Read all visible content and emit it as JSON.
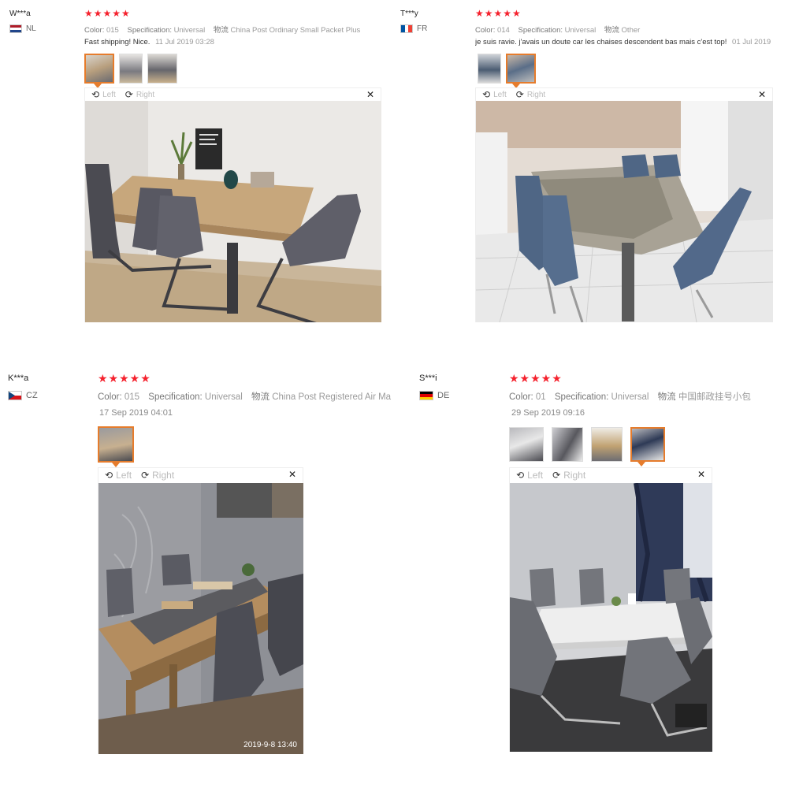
{
  "reviews": [
    {
      "user": "W***a",
      "country": "NL",
      "stars": "★★★★★",
      "color_label": "Color:",
      "color_value": "015",
      "spec_label": "Specification:",
      "spec_value": "Universal",
      "ship_label": "物流",
      "ship_value": "China Post Ordinary Small Packet Plus",
      "comment": "Fast shipping! Nice.",
      "date": "11 Jul 2019 03:28",
      "rotate_left": "Left",
      "rotate_right": "Right"
    },
    {
      "user": "T***y",
      "country": "FR",
      "stars": "★★★★★",
      "color_label": "Color:",
      "color_value": "014",
      "spec_label": "Specification:",
      "spec_value": "Universal",
      "ship_label": "物流",
      "ship_value": "Other",
      "comment": "je suis ravie. j'avais un doute car les chaises descendent bas mais c'est top!",
      "date": "01 Jul 2019",
      "rotate_left": "Left",
      "rotate_right": "Right"
    },
    {
      "user": "K***a",
      "country": "CZ",
      "stars": "★★★★★",
      "color_label": "Color:",
      "color_value": "015",
      "spec_label": "Specification:",
      "spec_value": "Universal",
      "ship_label": "物流",
      "ship_value": "China Post Registered Air Ma",
      "date": "17 Sep 2019 04:01",
      "rotate_left": "Left",
      "rotate_right": "Right",
      "photo_timestamp": "2019-9-8 13:40"
    },
    {
      "user": "S***i",
      "country": "DE",
      "stars": "★★★★★",
      "color_label": "Color:",
      "color_value": "01",
      "spec_label": "Specification:",
      "spec_value": "Universal",
      "ship_label": "物流",
      "ship_value": "中国邮政挂号小包",
      "date": "29 Sep 2019 09:16",
      "rotate_left": "Left",
      "rotate_right": "Right"
    }
  ],
  "icons": {
    "rotate_left": "rotate-left-icon",
    "rotate_right": "rotate-right-icon",
    "close": "close-icon"
  },
  "colors": {
    "star": "#f5212d",
    "selected_thumb": "#e67c2c"
  }
}
